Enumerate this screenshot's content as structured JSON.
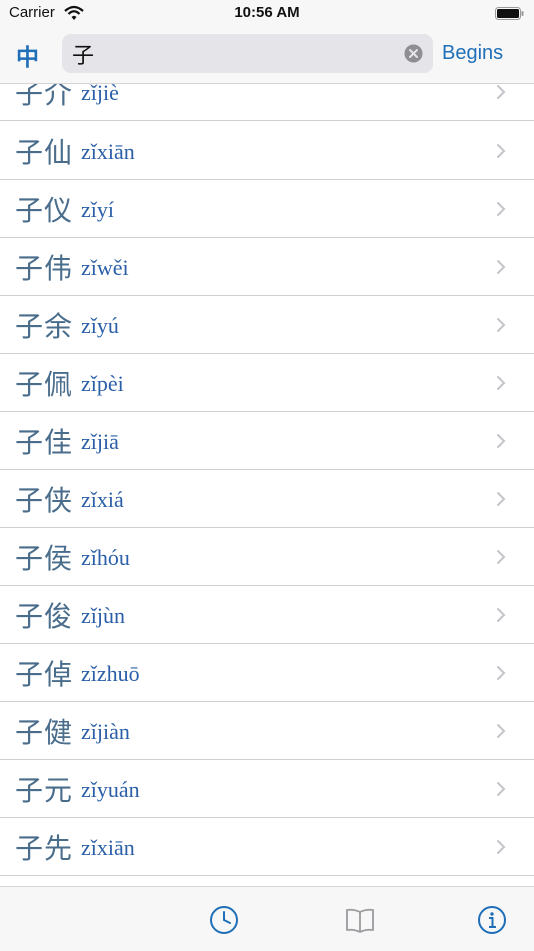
{
  "status": {
    "carrier": "Carrier",
    "time": "10:56 AM"
  },
  "header": {
    "lang_label": "中",
    "query": "子",
    "mode_label": "Begins"
  },
  "list": [
    {
      "hanzi": "子介",
      "pinyin": "zǐjiè"
    },
    {
      "hanzi": "子仙",
      "pinyin": "zǐxiān"
    },
    {
      "hanzi": "子仪",
      "pinyin": "zǐyí"
    },
    {
      "hanzi": "子伟",
      "pinyin": "zǐwěi"
    },
    {
      "hanzi": "子余",
      "pinyin": "zǐyú"
    },
    {
      "hanzi": "子佩",
      "pinyin": "zǐpèi"
    },
    {
      "hanzi": "子佳",
      "pinyin": "zǐjiā"
    },
    {
      "hanzi": "子侠",
      "pinyin": "zǐxiá"
    },
    {
      "hanzi": "子侯",
      "pinyin": "zǐhóu"
    },
    {
      "hanzi": "子俊",
      "pinyin": "zǐjùn"
    },
    {
      "hanzi": "子倬",
      "pinyin": "zǐzhuō"
    },
    {
      "hanzi": "子健",
      "pinyin": "zǐjiàn"
    },
    {
      "hanzi": "子元",
      "pinyin": "zǐyuán"
    },
    {
      "hanzi": "子先",
      "pinyin": "zǐxiān"
    }
  ],
  "tabs": [
    {
      "icon": "clock-icon"
    },
    {
      "icon": "book-icon"
    },
    {
      "icon": "info-icon"
    }
  ],
  "colors": {
    "accent": "#1f6fb8",
    "hanzi": "#4a6d8c",
    "pinyin": "#2a5fa8"
  }
}
